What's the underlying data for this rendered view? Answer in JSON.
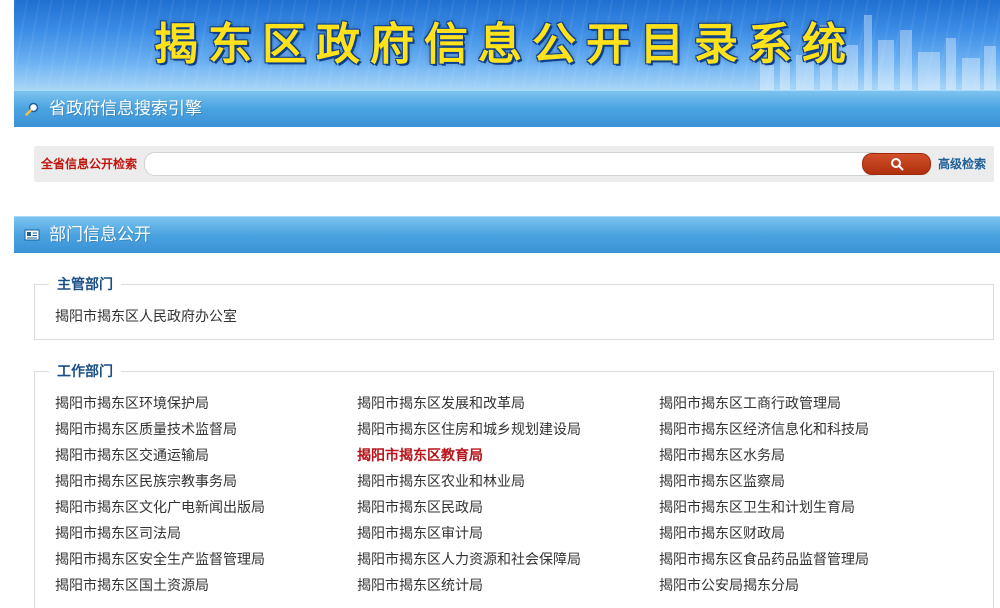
{
  "banner": {
    "title": "揭东区政府信息公开目录系统"
  },
  "search_section": {
    "title": "省政府信息搜索引擎",
    "label": "全省信息公开检索",
    "placeholder": "",
    "advanced_label": "高级检索",
    "search_icon": "search-icon",
    "bar_icon": "magnifier-icon"
  },
  "dept_section": {
    "title": "部门信息公开",
    "bar_icon": "news-icon"
  },
  "main_dept": {
    "legend": "主管部门",
    "items": [
      "揭阳市揭东区人民政府办公室"
    ]
  },
  "work_depts": {
    "legend": "工作部门",
    "columns": [
      [
        "揭阳市揭东区环境保护局",
        "揭阳市揭东区质量技术监督局",
        "揭阳市揭东区交通运输局",
        "揭阳市揭东区民族宗教事务局",
        "揭阳市揭东区文化广电新闻出版局",
        "揭阳市揭东区司法局",
        "揭阳市揭东区安全生产监督管理局",
        "揭阳市揭东区国土资源局"
      ],
      [
        "揭阳市揭东区发展和改革局",
        "揭阳市揭东区住房和城乡规划建设局",
        "揭阳市揭东区教育局",
        "揭阳市揭东区农业和林业局",
        "揭阳市揭东区民政局",
        "揭阳市揭东区审计局",
        "揭阳市揭东区人力资源和社会保障局",
        "揭阳市揭东区统计局"
      ],
      [
        "揭阳市揭东区工商行政管理局",
        "揭阳市揭东区经济信息化和科技局",
        "揭阳市揭东区水务局",
        "揭阳市揭东区监察局",
        "揭阳市揭东区卫生和计划生育局",
        "揭阳市揭东区财政局",
        "揭阳市揭东区食品药品监督管理局",
        "揭阳市公安局揭东分局"
      ]
    ],
    "highlighted": "揭阳市揭东区教育局"
  },
  "colors": {
    "banner_text": "#ffe21a",
    "bar_blue": "#4aa3e0",
    "label_red": "#c1140f",
    "link_blue": "#1f5f99",
    "highlight_red": "#b8131a"
  }
}
